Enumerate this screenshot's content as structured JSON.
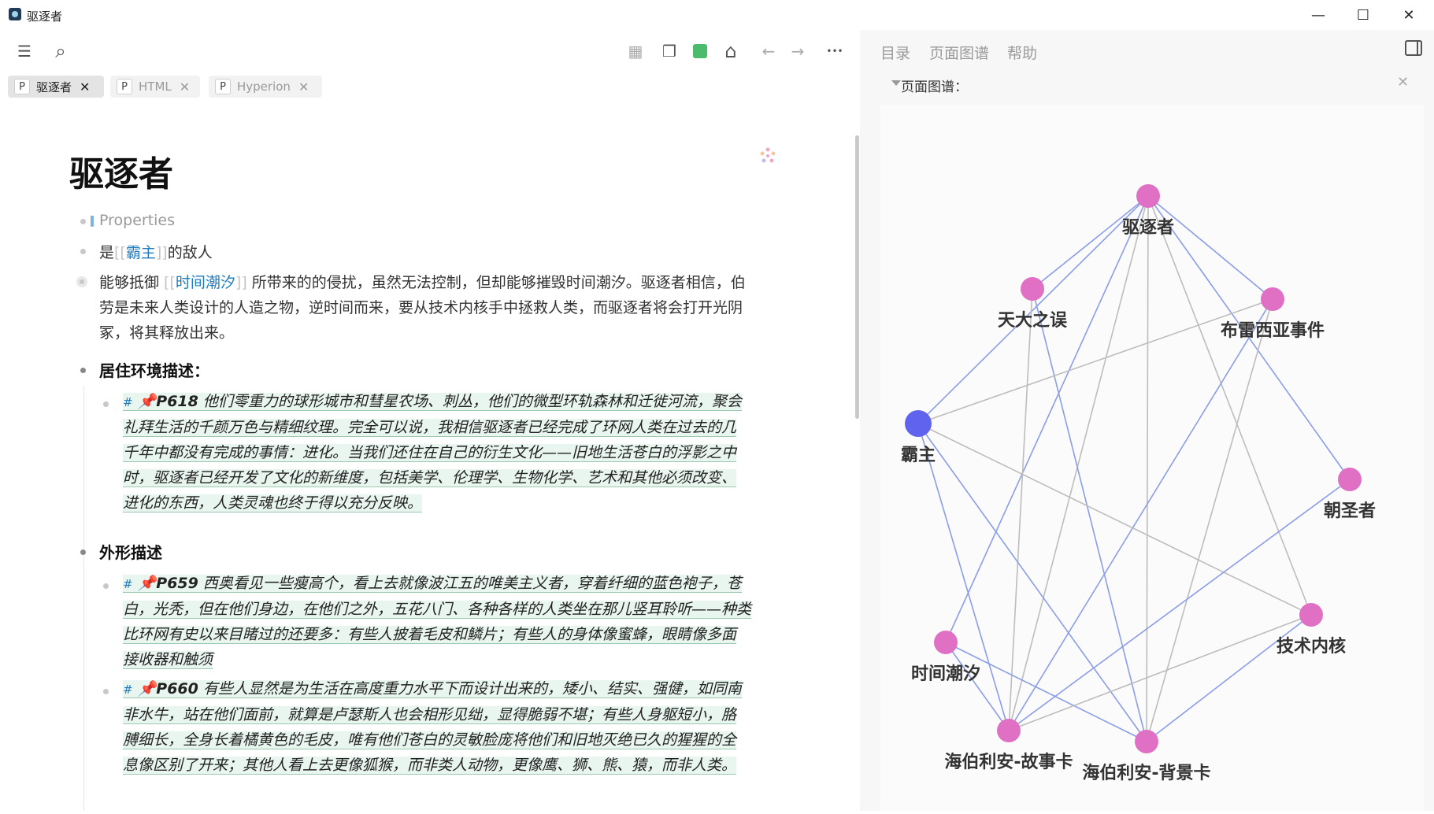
{
  "window": {
    "title": "驱逐者",
    "minimize": "—",
    "maximize": "☐",
    "close": "✕"
  },
  "toolbar": {
    "menu_icon": "☰",
    "search_icon": "⌕",
    "calendar_icon": "▦",
    "cube_icon": "❒",
    "home_icon": "⌂",
    "back_icon": "←",
    "forward_icon": "→",
    "more_icon": "•••",
    "accent": "#4cbb6c"
  },
  "tabs": [
    {
      "label": "驱逐者",
      "prefix": "P",
      "close": "✕",
      "active": true
    },
    {
      "label": "HTML",
      "prefix": "P",
      "close": "✕",
      "active": false
    },
    {
      "label": "Hyperion",
      "prefix": "P",
      "close": "✕",
      "active": false
    }
  ],
  "page": {
    "title": "驱逐者",
    "properties_label": "Properties",
    "block1": {
      "pre": "是",
      "link": "霸主",
      "post": "的敌人"
    },
    "block2": {
      "pre": "能够抵御",
      "link": "时间潮汐",
      "post": "所带来的的侵扰，虽然无法控制，但却能够摧毁时间潮汐。驱逐者相信，伯",
      "line2": "劳是未来人类设计的人造之物，逆时间而来，要从技术内核手中拯救人类，而驱逐者将会打开光阴",
      "line3": "冢，将其释放出来。"
    },
    "heading1": "居住环境描述：",
    "quote1": {
      "tag": "#",
      "pid": "P618",
      "lines": [
        "他们零重力的球形城市和彗星农场、刺丛，他们的微型环轨森林和迁徙河流，聚会",
        "礼拜生活的千颜万色与精细纹理。完全可以说，我相信驱逐者已经完成了环网人类在过去的几",
        "千年中都没有完成的事情：进化。当我们还住在自己的衍生文化——旧地生活苍白的浮影之中",
        "时，驱逐者已经开发了文化的新维度，包括美学、伦理学、生物化学、艺术和其他必须改变、",
        "进化的东西，人类灵魂也终于得以充分反映。"
      ]
    },
    "heading2": "外形描述",
    "quote2": {
      "tag": "#",
      "pid": "P659",
      "lines": [
        "西奥看见一些瘦高个，看上去就像波江五的唯美主义者，穿着纤细的蓝色袍子，苍",
        "白，光秃，但在他们身边，在他们之外，五花八门、各种各样的人类坐在那儿竖耳聆听——种类",
        "比环网有史以来目睹过的还要多：有些人披着毛皮和鳞片；有些人的身体像蜜蜂，眼睛像多面",
        "接收器和触须"
      ]
    },
    "quote3": {
      "tag": "#",
      "pid": "P660",
      "lines": [
        "有些人显然是为生活在高度重力水平下而设计出来的，矮小、结实、强健，如同南",
        "非水牛，站在他们面前，就算是卢瑟斯人也会相形见绌，显得脆弱不堪；有些人身躯短小，胳",
        "膊细长，全身长着橘黄色的毛皮，唯有他们苍白的灵敏脸庞将他们和旧地灭绝已久的猩猩的全",
        "息像区别了开来；其他人看上去更像狐猴，而非类人动物，更像鹰、狮、熊、猿，而非人类。"
      ]
    }
  },
  "right_panel": {
    "tabs": [
      "目录",
      "页面图谱",
      "帮助"
    ],
    "graph_title": "页面图谱：",
    "graph_close": "✕",
    "graph": {
      "nodes": [
        {
          "id": "驱逐者",
          "color": "#e070c4"
        },
        {
          "id": "天大之误",
          "color": "#e070c4"
        },
        {
          "id": "布雷西亚事件",
          "color": "#e070c4"
        },
        {
          "id": "霸主",
          "color": "#5f63ee"
        },
        {
          "id": "朝圣者",
          "color": "#e070c4"
        },
        {
          "id": "时间潮汐",
          "color": "#e070c4"
        },
        {
          "id": "技术内核",
          "color": "#e070c4"
        },
        {
          "id": "海伯利安-故事卡",
          "color": "#e070c4"
        },
        {
          "id": "海伯利安-背景卡",
          "color": "#e070c4"
        }
      ],
      "edges": [
        {
          "a": "驱逐者",
          "b": "天大之误",
          "color": "#8a9de9"
        },
        {
          "a": "驱逐者",
          "b": "布雷西亚事件",
          "color": "#8a9de9"
        },
        {
          "a": "驱逐者",
          "b": "霸主",
          "color": "#8a9de9"
        },
        {
          "a": "驱逐者",
          "b": "朝圣者",
          "color": "#8a9de9"
        },
        {
          "a": "驱逐者",
          "b": "时间潮汐",
          "color": "#8a9de9"
        },
        {
          "a": "驱逐者",
          "b": "技术内核",
          "color": "#bdbdbd"
        },
        {
          "a": "驱逐者",
          "b": "海伯利安-故事卡",
          "color": "#bdbdbd"
        },
        {
          "a": "驱逐者",
          "b": "海伯利安-背景卡",
          "color": "#bdbdbd"
        },
        {
          "a": "天大之误",
          "b": "海伯利安-故事卡",
          "color": "#bdbdbd"
        },
        {
          "a": "天大之误",
          "b": "海伯利安-背景卡",
          "color": "#8a9de9"
        },
        {
          "a": "布雷西亚事件",
          "b": "霸主",
          "color": "#bdbdbd"
        },
        {
          "a": "布雷西亚事件",
          "b": "海伯利安-故事卡",
          "color": "#8a9de9"
        },
        {
          "a": "布雷西亚事件",
          "b": "海伯利安-背景卡",
          "color": "#bdbdbd"
        },
        {
          "a": "霸主",
          "b": "海伯利安-故事卡",
          "color": "#8a9de9"
        },
        {
          "a": "霸主",
          "b": "海伯利安-背景卡",
          "color": "#8a9de9"
        },
        {
          "a": "霸主",
          "b": "技术内核",
          "color": "#bdbdbd"
        },
        {
          "a": "朝圣者",
          "b": "海伯利安-故事卡",
          "color": "#8a9de9"
        },
        {
          "a": "时间潮汐",
          "b": "海伯利安-故事卡",
          "color": "#8a9de9"
        },
        {
          "a": "时间潮汐",
          "b": "海伯利安-背景卡",
          "color": "#8a9de9"
        },
        {
          "a": "技术内核",
          "b": "海伯利安-故事卡",
          "color": "#bdbdbd"
        },
        {
          "a": "技术内核",
          "b": "海伯利安-背景卡",
          "color": "#8a9de9"
        }
      ]
    }
  }
}
